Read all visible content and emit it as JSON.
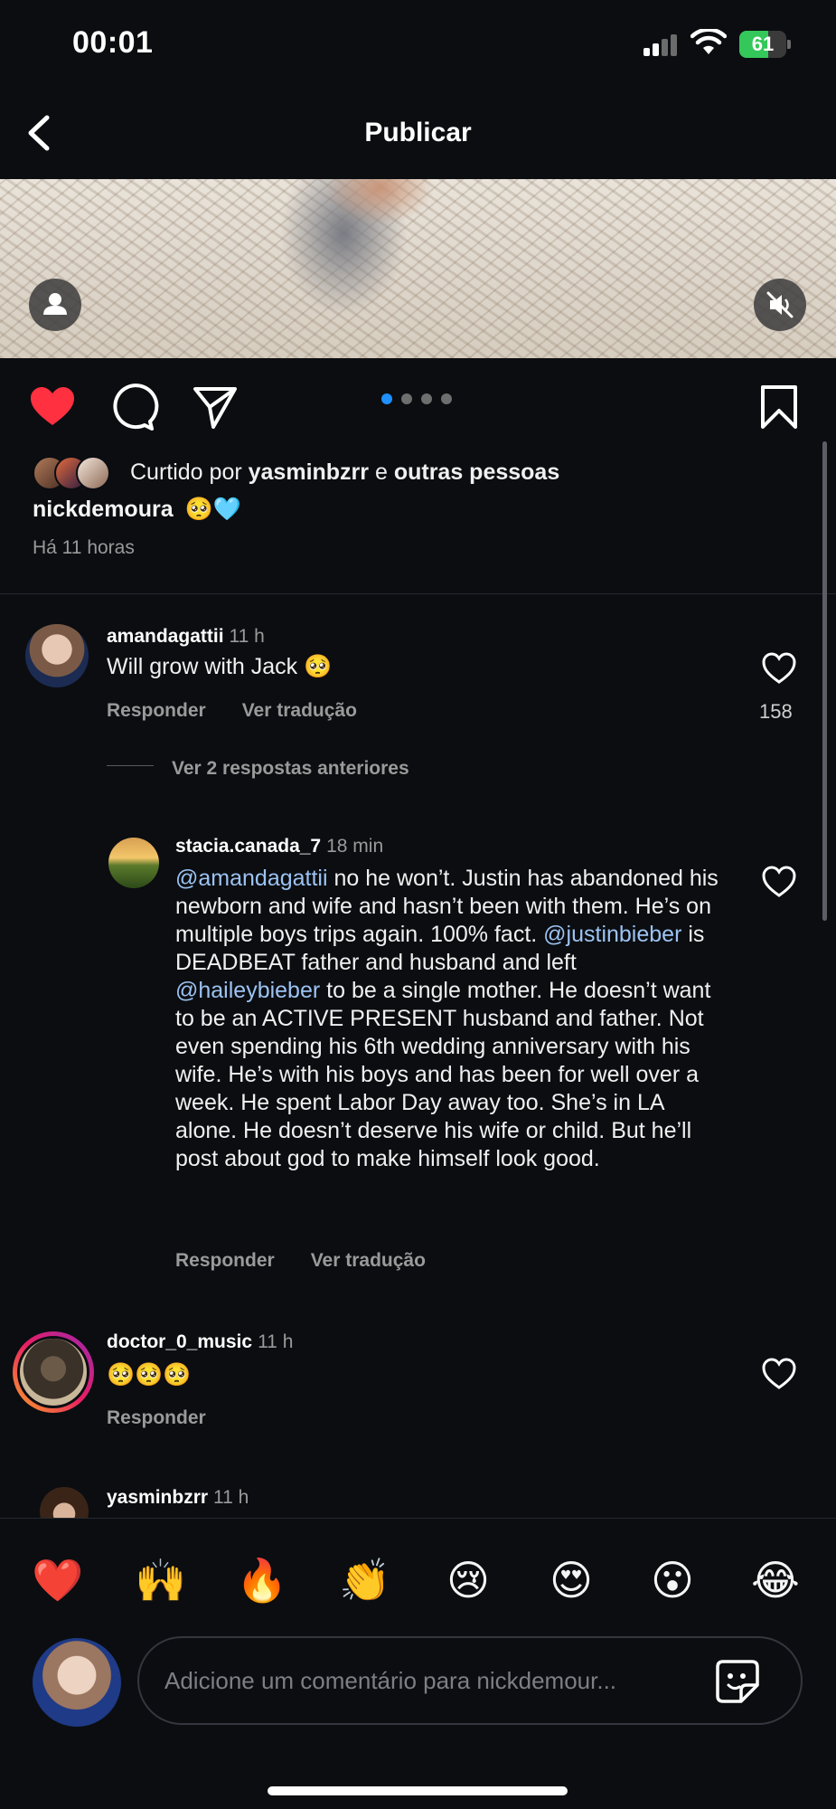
{
  "status_bar": {
    "time": "00:01",
    "battery": "61"
  },
  "header": {
    "title": "Publicar"
  },
  "post": {
    "carousel_active_index": 1,
    "carousel_count": 4,
    "likes": {
      "prefix": "Curtido por",
      "user": "yasminbzrr",
      "joiner": "e",
      "others": "outras pessoas"
    },
    "caption": {
      "user": "nickdemoura",
      "text": "🥺🩵"
    },
    "time": "Há 11 horas"
  },
  "comments": [
    {
      "user": "amandagattii",
      "time": "11 h",
      "text": "Will grow with Jack 🥺",
      "reply_label": "Responder",
      "translate_label": "Ver tradução",
      "like_count": "158"
    },
    {
      "view_previous": "Ver 2 respostas anteriores"
    },
    {
      "user": "stacia.canada_7",
      "time": "18 min",
      "mention1": "@amandagattii",
      "text1": " no he won’t. Justin has abandoned his newborn and wife and hasn’t been with them. He’s on multiple boys trips again. 100% fact. ",
      "mention2": "@justinbieber",
      "text2": " is DEADBEAT father and husband and left ",
      "mention3": "@haileybieber",
      "text3": " to be a single mother. He doesn’t want to be an ACTIVE PRESENT husband and father. Not even spending his 6th wedding anniversary with his wife. He’s with his boys and has been for well over a week. He spent Labor Day away too. She’s in LA alone.  He doesn’t deserve his wife or child. But he’ll post about god to make himself look good.",
      "reply_label": "Responder",
      "translate_label": "Ver tradução"
    },
    {
      "user": "doctor_0_music",
      "time": "11 h",
      "text": "🥺🥺🥺",
      "reply_label": "Responder"
    },
    {
      "user": "yasminbzrr",
      "time": "11 h"
    }
  ],
  "emoji_bar": [
    "❤️",
    "🙌",
    "🔥",
    "👏",
    "😢",
    "😍",
    "😮",
    "😂"
  ],
  "composer": {
    "placeholder": "Adicione um comentário para nickdemour..."
  },
  "colors": {
    "accent": "#1e90ff",
    "like": "#ff3040",
    "mention": "#9cc3f2"
  },
  "icons": [
    "back-icon",
    "user-icon",
    "mute-icon",
    "heart-icon",
    "comment-icon",
    "share-icon",
    "bookmark-icon",
    "sticker-icon"
  ]
}
